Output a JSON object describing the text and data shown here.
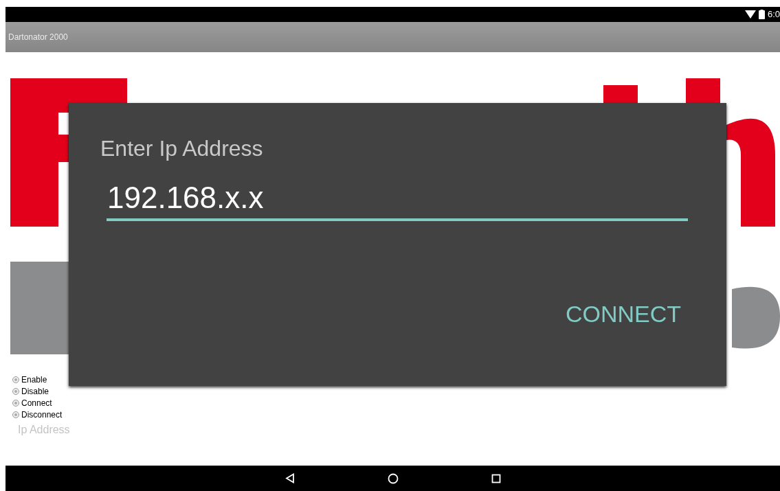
{
  "status_bar": {
    "time": "6:0"
  },
  "app_bar": {
    "title": "Dartonator 2000"
  },
  "radio_options": [
    {
      "label": "Enable",
      "selected": false
    },
    {
      "label": "Disable",
      "selected": false
    },
    {
      "label": "Connect",
      "selected": false
    },
    {
      "label": "Disconnect",
      "selected": false
    }
  ],
  "ip_field": {
    "placeholder": "Ip Address"
  },
  "dialog": {
    "title": "Enter Ip Address",
    "value": "192.168.x.x",
    "button": "CONNECT"
  }
}
